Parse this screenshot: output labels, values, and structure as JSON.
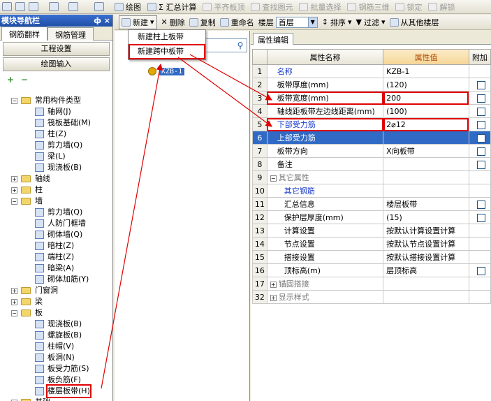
{
  "nav": {
    "title": "模块导航栏",
    "pin": "ф",
    "close": "×",
    "tabs": [
      "钢筋翻样",
      "钢筋管理"
    ],
    "buttons": [
      "工程设置",
      "绘图输入"
    ],
    "tree": [
      {
        "level": 1,
        "kind": "folder",
        "exp": "−",
        "label": "常用构件类型"
      },
      {
        "level": 2,
        "kind": "comp",
        "label": "轴网(J)"
      },
      {
        "level": 2,
        "kind": "comp",
        "label": "筏板基础(M)"
      },
      {
        "level": 2,
        "kind": "comp",
        "label": "柱(Z)"
      },
      {
        "level": 2,
        "kind": "comp",
        "label": "剪力墙(Q)"
      },
      {
        "level": 2,
        "kind": "comp",
        "label": "梁(L)"
      },
      {
        "level": 2,
        "kind": "comp",
        "label": "现浇板(B)"
      },
      {
        "level": 1,
        "kind": "folder",
        "exp": "+",
        "label": "轴线"
      },
      {
        "level": 1,
        "kind": "folder",
        "exp": "+",
        "label": "柱"
      },
      {
        "level": 1,
        "kind": "folder",
        "exp": "−",
        "label": "墙"
      },
      {
        "level": 2,
        "kind": "comp",
        "label": "剪力墙(Q)"
      },
      {
        "level": 2,
        "kind": "comp",
        "label": "人防门框墙"
      },
      {
        "level": 2,
        "kind": "comp",
        "label": "砌体墙(Q)"
      },
      {
        "level": 2,
        "kind": "comp",
        "label": "暗柱(Z)"
      },
      {
        "level": 2,
        "kind": "comp",
        "label": "端柱(Z)"
      },
      {
        "level": 2,
        "kind": "comp",
        "label": "暗梁(A)"
      },
      {
        "level": 2,
        "kind": "comp",
        "label": "砌体加筋(Y)"
      },
      {
        "level": 1,
        "kind": "folder",
        "exp": "+",
        "label": "门窗洞"
      },
      {
        "level": 1,
        "kind": "folder",
        "exp": "+",
        "label": "梁"
      },
      {
        "level": 1,
        "kind": "folder",
        "exp": "−",
        "label": "板"
      },
      {
        "level": 2,
        "kind": "comp",
        "label": "现浇板(B)"
      },
      {
        "level": 2,
        "kind": "comp",
        "label": "螺旋板(B)"
      },
      {
        "level": 2,
        "kind": "comp",
        "label": "柱帽(V)"
      },
      {
        "level": 2,
        "kind": "comp",
        "label": "板洞(N)"
      },
      {
        "level": 2,
        "kind": "comp",
        "label": "板受力筋(S)"
      },
      {
        "level": 2,
        "kind": "comp",
        "label": "板负筋(F)"
      },
      {
        "level": 2,
        "kind": "comp",
        "label": "楼层板带(H)",
        "selected": true
      },
      {
        "level": 1,
        "kind": "folder",
        "exp": "+",
        "label": "基础"
      }
    ]
  },
  "toolbar": {
    "items": [
      {
        "label": "绘图",
        "disabled": false
      },
      {
        "label": "Σ 汇总计算",
        "disabled": false
      },
      {
        "label": "平齐板顶",
        "disabled": true
      },
      {
        "label": "查找图元",
        "disabled": true
      },
      {
        "label": "批量选择",
        "disabled": true
      },
      {
        "label": "钢筋三维",
        "disabled": true
      },
      {
        "label": "锁定",
        "disabled": true
      },
      {
        "label": "解锁",
        "disabled": true
      }
    ]
  },
  "toolbar2": {
    "new_label": "新建",
    "delete_label": "删除",
    "copy_label": "复制",
    "rename_label": "重命名",
    "floor_label": "楼层",
    "floor_value": "首层",
    "sort_label": "排序",
    "filter_label": "过滤",
    "copy_from_label": "从其他楼层"
  },
  "menu": {
    "items": [
      "新建柱上板带",
      "新建跨中板带"
    ]
  },
  "mid": {
    "node_label": "KZB-1"
  },
  "prop": {
    "tab": "属性编辑",
    "headers": {
      "name": "属性名称",
      "value": "属性值",
      "extra": "附加"
    },
    "rows": [
      {
        "n": "1",
        "name": "名称",
        "value": "KZB-1",
        "style": "blue",
        "chk": false
      },
      {
        "n": "2",
        "name": "板带厚度(mm)",
        "value": "(120)",
        "style": "",
        "chk": true
      },
      {
        "n": "3",
        "name": "板带宽度(mm)",
        "value": "200",
        "style": "",
        "chk": true,
        "boxName": true,
        "boxValue": true
      },
      {
        "n": "4",
        "name": "轴线距板带左边线距离(mm)",
        "value": "(100)",
        "style": "",
        "chk": true
      },
      {
        "n": "5",
        "name": "下部受力筋",
        "value": "2⌀12",
        "style": "blue",
        "chk": true,
        "boxName": true,
        "boxValue": true
      },
      {
        "n": "6",
        "name": "上部受力筋",
        "value": "",
        "style": "",
        "chk": true,
        "selected": true
      },
      {
        "n": "7",
        "name": "板带方向",
        "value": "X向板带",
        "style": "",
        "chk": true
      },
      {
        "n": "8",
        "name": "备注",
        "value": "",
        "style": "",
        "chk": true
      },
      {
        "n": "9",
        "name": "其它属性",
        "value": "",
        "style": "gray",
        "exp": "−",
        "chk": false
      },
      {
        "n": "10",
        "name": "其它钢筋",
        "value": "",
        "style": "sub blue",
        "chk": false
      },
      {
        "n": "11",
        "name": "汇总信息",
        "value": "楼层板带",
        "style": "sub",
        "chk": true
      },
      {
        "n": "12",
        "name": "保护层厚度(mm)",
        "value": "(15)",
        "style": "sub",
        "chk": true
      },
      {
        "n": "13",
        "name": "计算设置",
        "value": "按默认计算设置计算",
        "style": "sub",
        "chk": false
      },
      {
        "n": "14",
        "name": "节点设置",
        "value": "按默认节点设置计算",
        "style": "sub",
        "chk": false
      },
      {
        "n": "15",
        "name": "搭接设置",
        "value": "按默认搭接设置计算",
        "style": "sub",
        "chk": false
      },
      {
        "n": "16",
        "name": "顶标高(m)",
        "value": "层顶标高",
        "style": "sub",
        "chk": true
      },
      {
        "n": "17",
        "name": "锚固搭接",
        "value": "",
        "style": "gray",
        "exp": "+",
        "chk": false
      },
      {
        "n": "32",
        "name": "显示样式",
        "value": "",
        "style": "gray",
        "exp": "+",
        "chk": false
      }
    ]
  }
}
